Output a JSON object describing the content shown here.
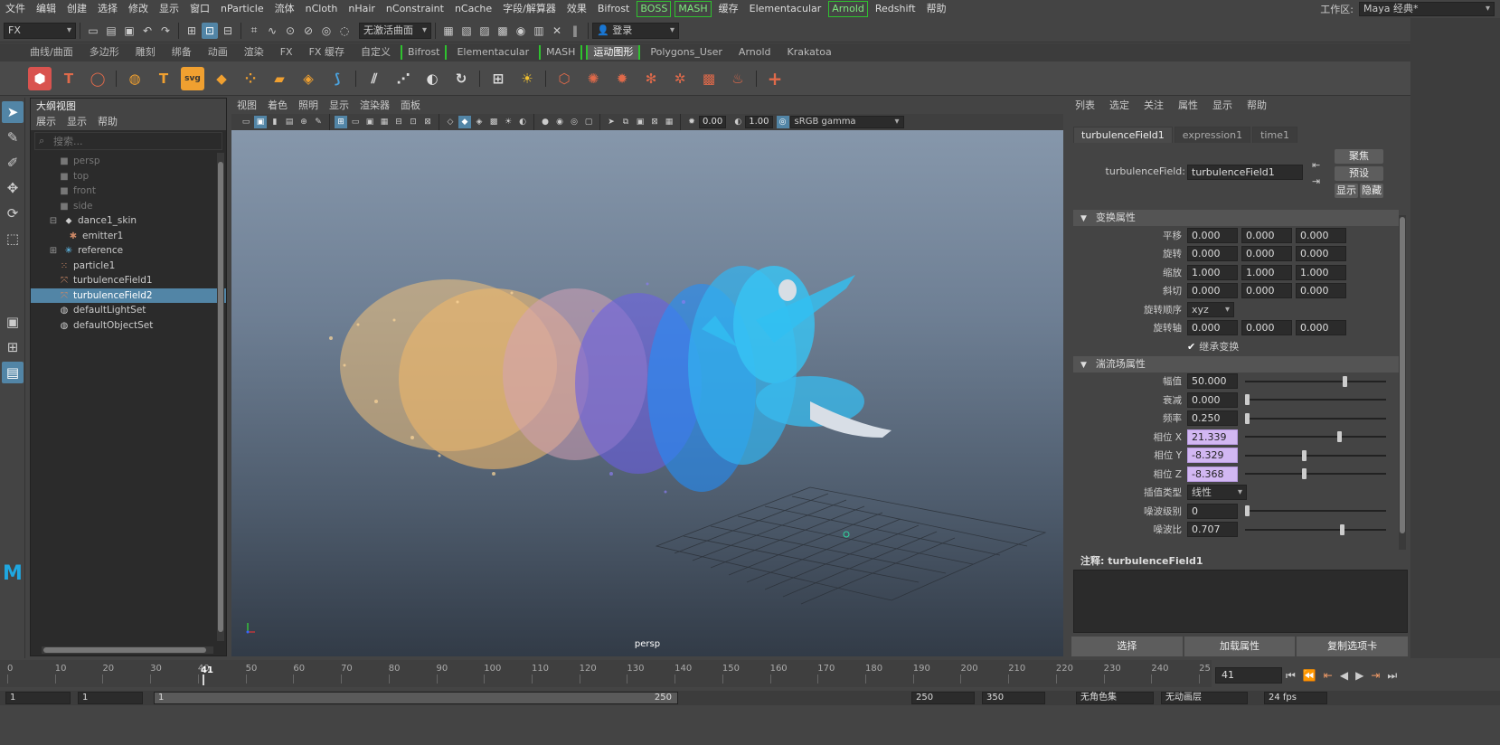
{
  "menubar": {
    "items": [
      "文件",
      "编辑",
      "创建",
      "选择",
      "修改",
      "显示",
      "窗口",
      "nParticle",
      "流体",
      "nCloth",
      "nHair",
      "nConstraint",
      "nCache",
      "字段/解算器",
      "效果",
      "Bifrost",
      "BOSS",
      "MASH",
      "缓存",
      "Elementacular",
      "Arnold",
      "Redshift",
      "帮助"
    ],
    "workspace_label": "工作区:",
    "workspace_value": "Maya 经典*"
  },
  "statusline": {
    "mode": "FX",
    "live_surface": "无激活曲面",
    "login": "登录"
  },
  "shelf_tabs": [
    "曲线/曲面",
    "多边形",
    "雕刻",
    "绑备",
    "动画",
    "渲染",
    "FX",
    "FX 缓存",
    "自定义",
    "Bifrost",
    "Elementacular",
    "MASH",
    "运动图形",
    "Polygons_User",
    "Arnold",
    "Krakatoa"
  ],
  "shelf_active_tab": "运动图形",
  "outliner": {
    "title": "大纲视图",
    "menu": [
      "展示",
      "显示",
      "帮助"
    ],
    "search_placeholder": "搜索...",
    "items": [
      {
        "label": "persp",
        "icon": "camera-icon"
      },
      {
        "label": "top",
        "icon": "camera-icon"
      },
      {
        "label": "front",
        "icon": "camera-icon"
      },
      {
        "label": "side",
        "icon": "camera-icon"
      },
      {
        "label": "dance1_skin",
        "icon": "mesh-icon"
      },
      {
        "label": "emitter1",
        "icon": "emitter-icon"
      },
      {
        "label": "reference",
        "icon": "locator-icon"
      },
      {
        "label": "particle1",
        "icon": "particle-icon"
      },
      {
        "label": "turbulenceField1",
        "icon": "field-icon"
      },
      {
        "label": "turbulenceField2",
        "icon": "field-icon"
      },
      {
        "label": "defaultLightSet",
        "icon": "set-icon"
      },
      {
        "label": "defaultObjectSet",
        "icon": "set-icon"
      }
    ]
  },
  "viewport": {
    "menu": [
      "视图",
      "着色",
      "照明",
      "显示",
      "渲染器",
      "面板"
    ],
    "exposure": "0.00",
    "gamma": "1.00",
    "color_space": "sRGB gamma",
    "camera_label": "persp"
  },
  "attribute_editor": {
    "menu": [
      "列表",
      "选定",
      "关注",
      "属性",
      "显示",
      "帮助"
    ],
    "tabs": [
      "turbulenceField1",
      "expression1",
      "time1"
    ],
    "node_label": "turbulenceField:",
    "node_value": "turbulenceField1",
    "buttons": {
      "focus": "聚焦",
      "presets": "预设",
      "show": "显示",
      "hide": "隐藏"
    },
    "transform_section": "变换属性",
    "transform": {
      "translate": {
        "label": "平移",
        "values": [
          "0.000",
          "0.000",
          "0.000"
        ]
      },
      "rotate": {
        "label": "旋转",
        "values": [
          "0.000",
          "0.000",
          "0.000"
        ]
      },
      "scale": {
        "label": "缩放",
        "values": [
          "1.000",
          "1.000",
          "1.000"
        ]
      },
      "shear": {
        "label": "斜切",
        "values": [
          "0.000",
          "0.000",
          "0.000"
        ]
      },
      "rotate_order": {
        "label": "旋转顺序",
        "value": "xyz"
      },
      "rotate_axis": {
        "label": "旋转轴",
        "values": [
          "0.000",
          "0.000",
          "0.000"
        ]
      },
      "inherit": "继承变换"
    },
    "turbulence_section": "湍流场属性",
    "turbulence": [
      {
        "label": "幅值",
        "value": "50.000",
        "slider": 0.72,
        "highlight": false
      },
      {
        "label": "衰减",
        "value": "0.000",
        "slider": 0.0,
        "highlight": false
      },
      {
        "label": "频率",
        "value": "0.250",
        "slider": 0.0,
        "highlight": false
      },
      {
        "label": "相位 X",
        "value": "21.339",
        "slider": 0.68,
        "highlight": true
      },
      {
        "label": "相位 Y",
        "value": "-8.329",
        "slider": 0.42,
        "highlight": true
      },
      {
        "label": "相位 Z",
        "value": "-8.368",
        "slider": 0.42,
        "highlight": true
      },
      {
        "label": "插值类型",
        "value": "线性",
        "slider": null,
        "highlight": false
      },
      {
        "label": "噪波级别",
        "value": "0",
        "slider": 0.0,
        "highlight": false
      },
      {
        "label": "噪波比",
        "value": "0.707",
        "slider": 0.7,
        "highlight": false
      }
    ],
    "notes_label": "注释:",
    "notes_node": "turbulenceField1",
    "bottom_buttons": [
      "选择",
      "加载属性",
      "复制选项卡"
    ]
  },
  "timeline": {
    "ticks": [
      "0",
      "10",
      "20",
      "30",
      "40",
      "50",
      "60",
      "70",
      "80",
      "90",
      "100",
      "110",
      "120",
      "130",
      "140",
      "150",
      "160",
      "170",
      "180",
      "190",
      "200",
      "210",
      "220",
      "230",
      "240",
      "25"
    ],
    "current_frame": "41",
    "current_frame_field": "41"
  },
  "range": {
    "start": "1",
    "start2": "1",
    "range_start": "1",
    "range_end": "250",
    "end": "250",
    "end2": "350",
    "char_set": "无角色集",
    "anim_layer": "无动画层",
    "fps": "24 fps"
  },
  "colors": {
    "selection": "#5285a6",
    "highlight_field": "#d2b7f2",
    "bracket_green": "#2fc22f"
  }
}
